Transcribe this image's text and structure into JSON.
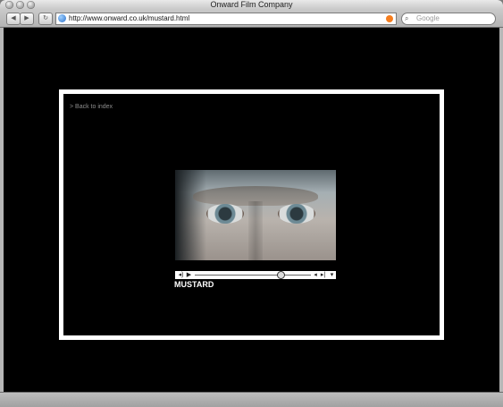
{
  "window": {
    "title": "Onward Film Company"
  },
  "toolbar": {
    "back_label": "◀",
    "forward_label": "▶",
    "reload_label": "↻",
    "url": "http://www.onward.co.uk/mustard.html",
    "search_placeholder": "Google"
  },
  "page": {
    "back_link": "> Back to index",
    "video_title": "MUSTARD",
    "player": {
      "volume_icon": "speaker-icon",
      "play_icon": "play-icon",
      "progress": 0.74,
      "mute_icon": "mute-icon",
      "menu_icon": "chevron-down-icon"
    }
  }
}
